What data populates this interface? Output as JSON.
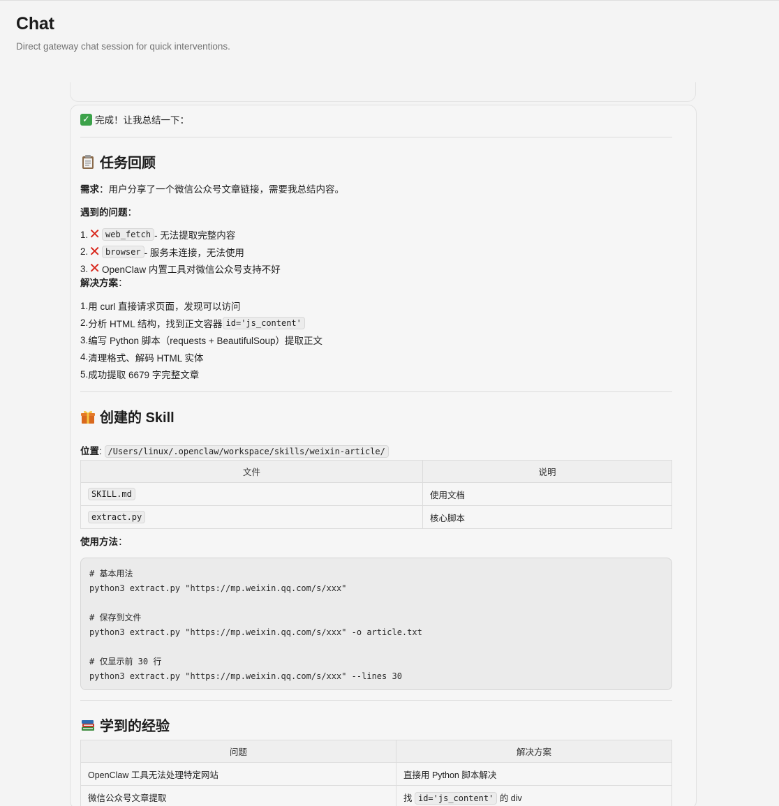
{
  "header": {
    "title": "Chat",
    "subtitle": "Direct gateway chat session for quick interventions."
  },
  "message": {
    "intro": "完成！让我总结一下：",
    "review": {
      "heading": "任务回顾",
      "need_label": "需求",
      "need_text": "：用户分享了一个微信公众号文章链接，需要我总结内容。",
      "problems_label": "遇到的问题",
      "colon": "：",
      "problems": [
        {
          "num": "1.",
          "code": "web_fetch",
          "text": " - 无法提取完整内容"
        },
        {
          "num": "2.",
          "code": "browser",
          "text": " - 服务未连接，无法使用"
        },
        {
          "num": "3.",
          "code": "",
          "text": "OpenClaw 内置工具对微信公众号支持不好"
        }
      ],
      "solution_label": "解决方案",
      "solutions": [
        {
          "num": "1.",
          "text": "用 curl 直接请求页面，发现可以访问",
          "code": ""
        },
        {
          "num": "2.",
          "text": "分析 HTML 结构，找到正文容器 ",
          "code": "id='js_content'"
        },
        {
          "num": "3.",
          "text": "编写 Python 脚本（requests + BeautifulSoup）提取正文",
          "code": ""
        },
        {
          "num": "4.",
          "text": "清理格式、解码 HTML 实体",
          "code": ""
        },
        {
          "num": "5.",
          "text": "成功提取 6679 字完整文章",
          "code": ""
        }
      ]
    },
    "skill": {
      "heading": "创建的 Skill",
      "location_label": "位置",
      "location_colon": ": ",
      "location_path": "/Users/linux/.openclaw/workspace/skills/weixin-article/",
      "table_headers": [
        "文件",
        "说明"
      ],
      "table_rows": [
        {
          "file": "SKILL.md",
          "desc": "使用文档"
        },
        {
          "file": "extract.py",
          "desc": "核心脚本"
        }
      ],
      "usage_label": "使用方法",
      "code": "# 基本用法\npython3 extract.py \"https://mp.weixin.qq.com/s/xxx\"\n\n# 保存到文件\npython3 extract.py \"https://mp.weixin.qq.com/s/xxx\" -o article.txt\n\n# 仅显示前 30 行\npython3 extract.py \"https://mp.weixin.qq.com/s/xxx\" --lines 30"
    },
    "lessons": {
      "heading": "学到的经验",
      "table_headers": [
        "问题",
        "解决方案"
      ],
      "table_rows": [
        {
          "problem": "OpenClaw 工具无法处理特定网站",
          "solution_pre": "直接用 Python 脚本解决",
          "solution_code": "",
          "solution_post": ""
        },
        {
          "problem": "微信公众号文章提取",
          "solution_pre": "找 ",
          "solution_code": "id='js_content'",
          "solution_post": " 的 div"
        }
      ]
    }
  },
  "icons": {
    "check": "check-mark-icon",
    "clipboard": "clipboard-icon",
    "gift": "gift-icon",
    "books": "books-icon",
    "cross": "cross-mark-icon"
  },
  "colors": {
    "check_green": "#3ca24a",
    "cross_red": "#d8261b"
  }
}
